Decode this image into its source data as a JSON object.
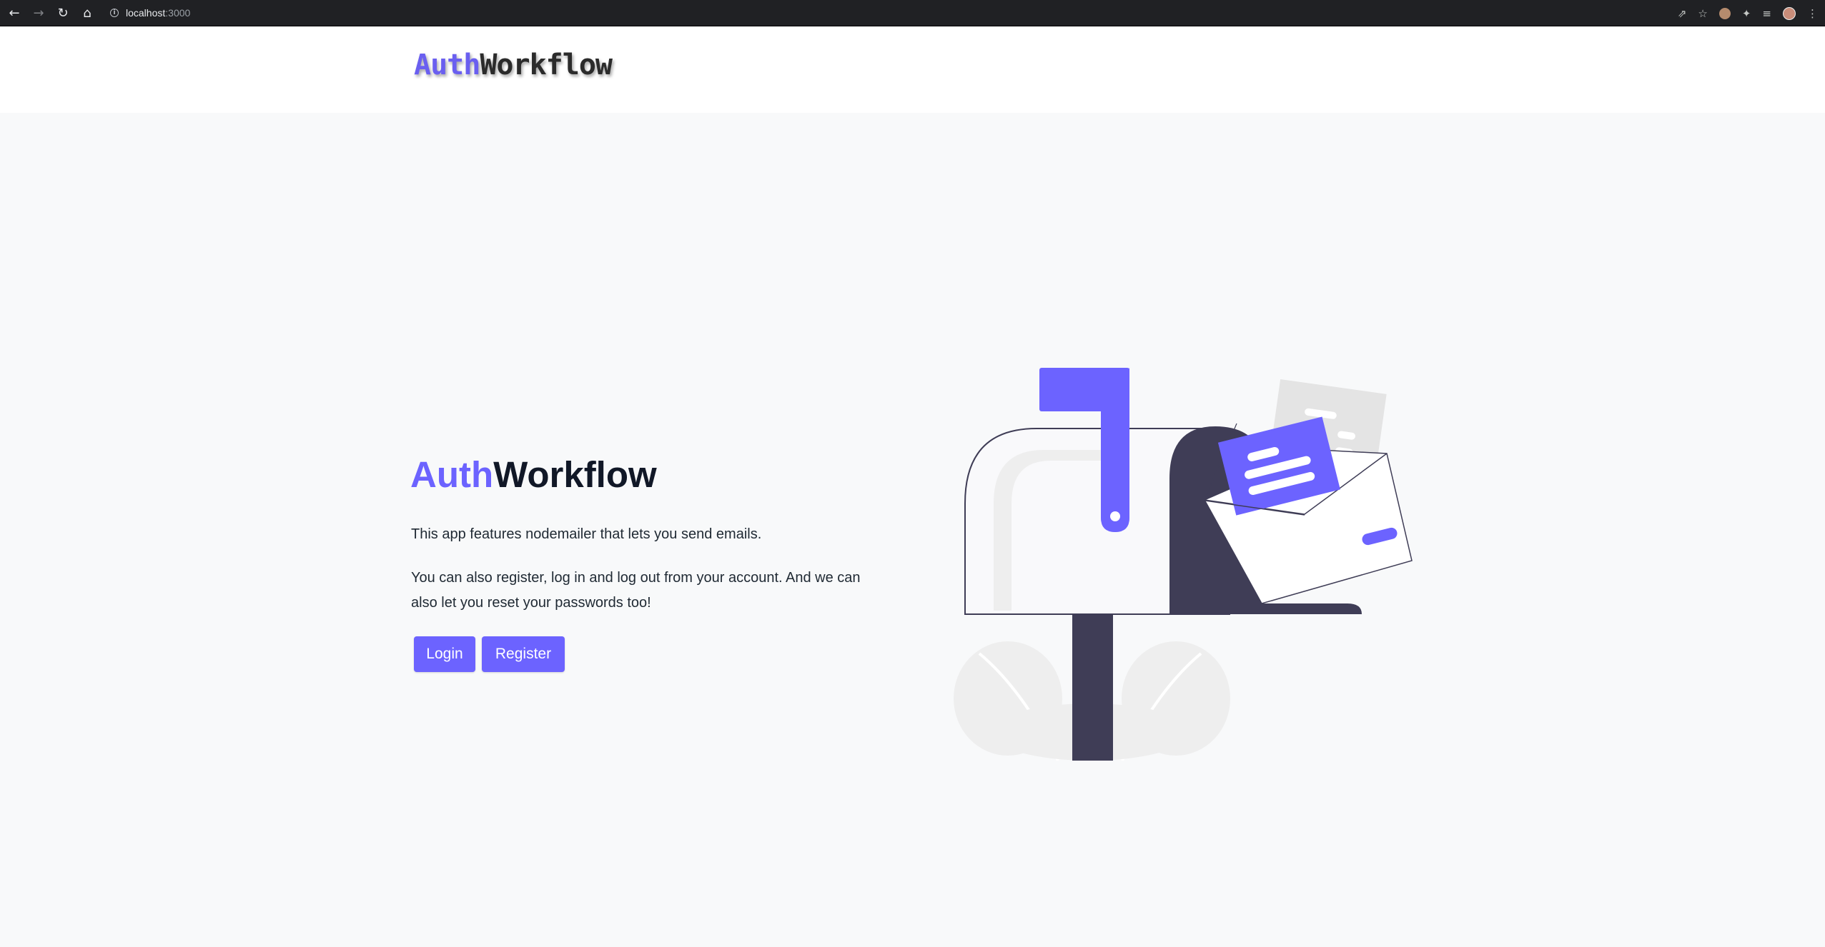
{
  "browser": {
    "url_host": "localhost",
    "url_port": ":3000",
    "icons": [
      "back-icon",
      "forward-icon",
      "reload-icon",
      "home-icon",
      "info-icon",
      "share-icon",
      "star-icon",
      "extension-icon",
      "puzzle-icon",
      "reading-list-icon",
      "profile-avatar",
      "menu-icon"
    ]
  },
  "header": {
    "brand_accent": "Auth",
    "brand_rest": "Workflow"
  },
  "hero": {
    "title_accent": "Auth",
    "title_rest": "Workflow",
    "paragraph1": "This app features nodemailer that lets you send emails.",
    "paragraph2": "You can also register, log in and log out from your account. And we can also let you reset your passwords too!",
    "login_label": "Login",
    "register_label": "Register",
    "illustration": "mailbox-illustration"
  },
  "colors": {
    "accent": "#6c63ff",
    "dark": "#111827",
    "background": "#f8f9fa",
    "illustration_dark": "#3f3d56"
  }
}
